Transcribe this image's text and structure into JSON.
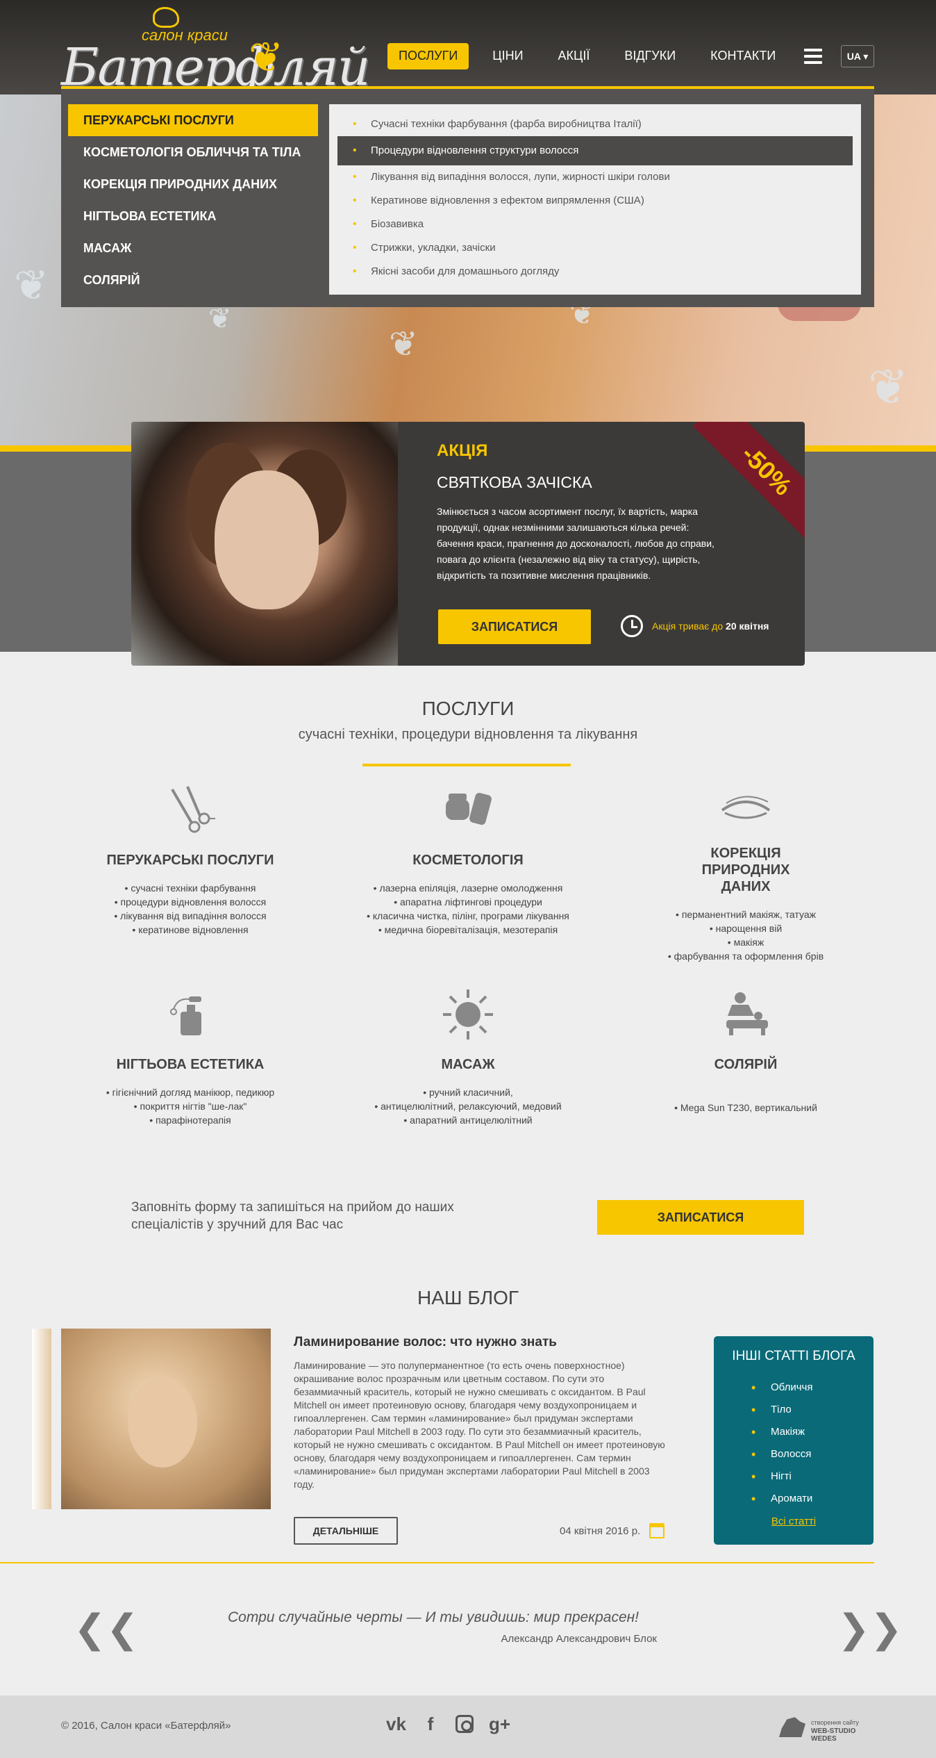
{
  "header": {
    "logo_sub": "салон краси",
    "logo_main": "Батерфляй",
    "nav": [
      "ПОСЛУГИ",
      "ЦІНИ",
      "АКЦІЇ",
      "ВІДГУКИ",
      "КОНТАКТИ"
    ],
    "lang": "UA ▾",
    "accent_color": "#f7c600"
  },
  "mega_menu": {
    "categories": [
      "ПЕРУКАРСЬКІ ПОСЛУГИ",
      "КОСМЕТОЛОГІЯ ОБЛИЧЧЯ ТА ТІЛА",
      "КОРЕКЦІЯ ПРИРОДНИХ ДАНИХ",
      "НІГТЬОВА ЕСТЕТИКА",
      "МАСАЖ",
      "СОЛЯРІЙ"
    ],
    "items": [
      "Сучасні техніки фарбування (фарба виробництва Італії)",
      "Процедури відновлення структури волосся",
      "Лікування від випадіння волосся, лупи, жирності шкіри голови",
      "Кератинове відновлення з ефектом випрямлення (США)",
      "Біозавивка",
      "Стрижки, укладки, зачіски",
      "Якісні засоби для домашнього догляду"
    ]
  },
  "promo": {
    "label": "АКЦІЯ",
    "title": "СВЯТКОВА ЗАЧІСКА",
    "text": "Змінюється з часом асортимент послуг, їх вартість, марка продукції, однак незмінними залишаються кілька речей: бачення краси, прагнення до досконалості, любов до справи, повага до клієнта (незалежно від віку та статусу), щирість, відкритість та позитивне мислення працівників.",
    "button": "ЗАПИСАТИСЯ",
    "until_prefix": "Акція триває до",
    "until_date": "20 квітня",
    "discount": "-50%"
  },
  "services": {
    "title": "ПОСЛУГИ",
    "subtitle": "сучасні техніки, процедури відновлення та лікування",
    "items": [
      {
        "name": "ПЕРУКАРСЬКІ ПОСЛУГИ",
        "icon": "scissors-icon",
        "list": [
          "сучасні техніки фарбування",
          "процедури відновлення волосся",
          "лікування від випадіння волосся",
          "кератинове відновлення"
        ]
      },
      {
        "name": "КОСМЕТОЛОГІЯ",
        "icon": "cosmetics-icon",
        "list": [
          "лазерна епіляція, лазерне омолодження",
          "апаратна ліфтингові процедури",
          "класична чистка, пілінг, програми лікування",
          "медична біоревіталізація, мезотерапія"
        ]
      },
      {
        "name": "КОРЕКЦІЯ ПРИРОДНИХ ДАНИХ",
        "icon": "eye-icon",
        "list": [
          "перманентний макіяж, татуаж",
          "нарощення вій",
          "макіяж",
          "фарбування та оформлення брів"
        ]
      },
      {
        "name": "НІГТЬОВА ЕСТЕТИКА",
        "icon": "perfume-icon",
        "list": [
          "гігієнічний догляд  манікюр, педикюр",
          "покриття нігтів \"ше-лак\"",
          "парафінотерапія"
        ]
      },
      {
        "name": "МАСАЖ",
        "icon": "sun-icon",
        "list": [
          "ручний  класичний,",
          "антицелюлітний, релаксуючий, медовий",
          "апаратний  антицелюлітний"
        ]
      },
      {
        "name": "СОЛЯРІЙ",
        "icon": "massage-icon",
        "list": [
          "Mega Sun T230, вертикальний"
        ]
      }
    ]
  },
  "cta": {
    "text": "Заповніть форму та запишіться на прийом до наших спеціалістів у зручний для Вас час",
    "button": "ЗАПИСАТИСЯ"
  },
  "blog": {
    "title": "НАШ БЛОГ",
    "post_title": "Ламинирование волос: что нужно знать",
    "post_text": "Ламинирование — это полуперманентное (то есть очень поверхностное) окрашивание волос прозрачным или цветным составом. По сути это безаммиачный краситель, который не нужно смешивать с оксидантом. В Paul Mitchell он имеет протеиновую основу, благодаря чему воздухопроницаем и гипоаллергенен. Сам термин «ламинирование» был придуман экспертами лаборатории Paul Mitchell в 2003 году. По сути это безаммиачный краситель, который не нужно смешивать с оксидантом. В Paul Mitchell он имеет протеиновую основу, благодаря чему воздухопроницаем и гипоаллергенен. Сам термин «ламинирование» был придуман экспертами лаборатории Paul Mitchell в 2003 году.",
    "more_button": "ДЕТАЛЬНІШЕ",
    "date": "04 квітня 2016 р.",
    "others_title": "ІНШІ СТАТТІ БЛОГА",
    "others": [
      "Обличчя",
      "Тіло",
      "Макіяж",
      "Волосся",
      "Нігті",
      "Аромати"
    ],
    "others_all": "Всі статті"
  },
  "quote": {
    "text": "Сотри случайные черты — И ты увидишь: мир прекрасен!",
    "author": "Александр Александрович Блок",
    "prev": "❮❮",
    "next": "❯❯"
  },
  "footer": {
    "copyright": "© 2016, Салон краси «Батерфляй»",
    "social": [
      "vk",
      "f",
      "ig",
      "g+"
    ],
    "studio_line1": "створення сайту",
    "studio_line2": "WEB-STUDIO WEDES"
  }
}
